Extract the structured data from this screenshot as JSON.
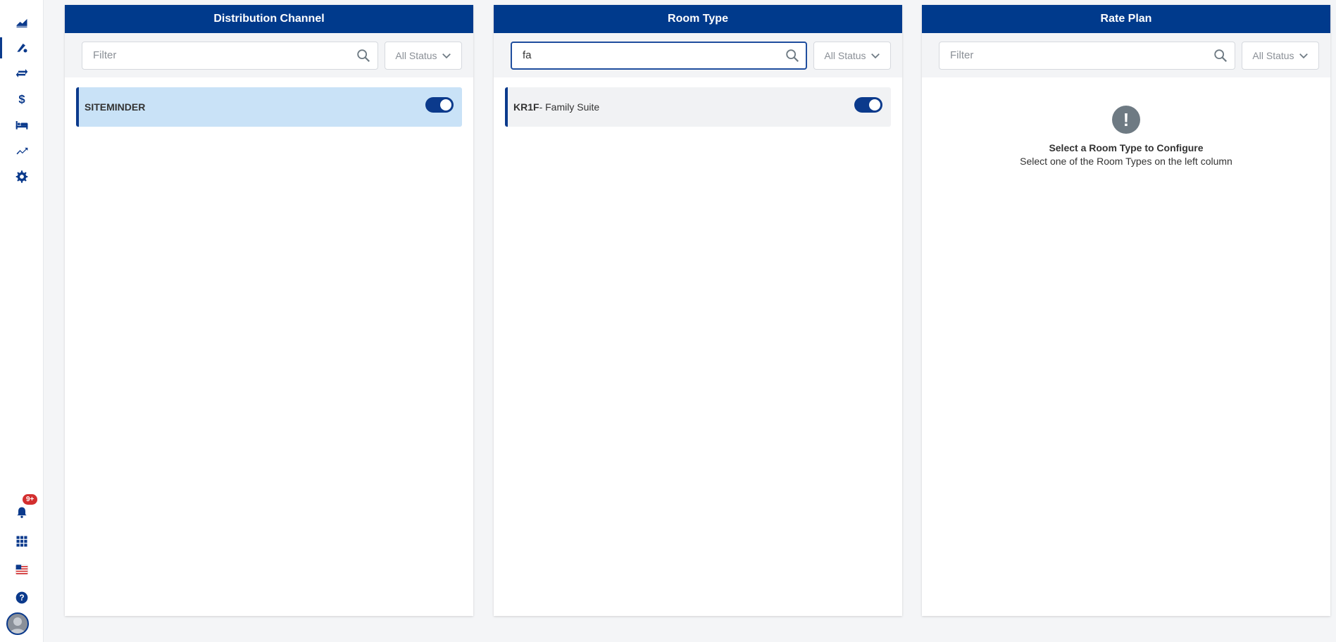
{
  "sidebar": {
    "nav": [
      {
        "icon": "dashboard-chart-icon"
      },
      {
        "icon": "distribution-icon",
        "active": true
      },
      {
        "icon": "transfer-arrows-icon"
      },
      {
        "icon": "dollar-icon"
      },
      {
        "icon": "bed-icon"
      },
      {
        "icon": "trending-up-icon"
      },
      {
        "icon": "gear-icon"
      }
    ],
    "notifications_badge": "9+",
    "bottom": [
      {
        "icon": "bell-icon"
      },
      {
        "icon": "apps-grid-icon"
      },
      {
        "icon": "us-flag-icon"
      },
      {
        "icon": "help-icon"
      },
      {
        "icon": "avatar-icon"
      }
    ]
  },
  "panels": {
    "distribution": {
      "title": "Distribution Channel",
      "filter_value": "",
      "filter_placeholder": "Filter",
      "status_label": "All Status",
      "items": [
        {
          "code": "SITEMINDER",
          "name": "",
          "enabled": true,
          "selected": true
        }
      ]
    },
    "room_type": {
      "title": "Room Type",
      "filter_value": "fa",
      "filter_placeholder": "Filter",
      "status_label": "All Status",
      "items": [
        {
          "code": "KR1F",
          "separator": "- ",
          "name": "Family Suite",
          "enabled": true,
          "selected": false
        }
      ]
    },
    "rate_plan": {
      "title": "Rate Plan",
      "filter_value": "",
      "filter_placeholder": "Filter",
      "status_label": "All Status",
      "empty_icon_glyph": "!",
      "empty_title": "Select a Room Type to Configure",
      "empty_subtitle": "Select one of the Room Types on the left column"
    }
  },
  "colors": {
    "primary": "#003a8c",
    "selected_row": "#c9e2f7",
    "badge": "#d32f2f"
  }
}
